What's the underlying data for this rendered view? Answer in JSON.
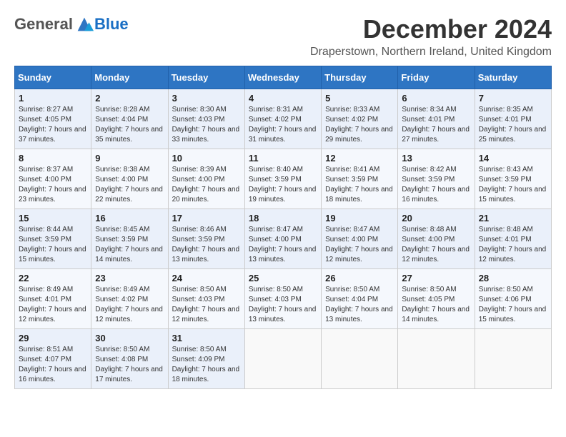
{
  "header": {
    "logo_general": "General",
    "logo_blue": "Blue",
    "main_title": "December 2024",
    "subtitle": "Draperstown, Northern Ireland, United Kingdom"
  },
  "calendar": {
    "days_of_week": [
      "Sunday",
      "Monday",
      "Tuesday",
      "Wednesday",
      "Thursday",
      "Friday",
      "Saturday"
    ],
    "weeks": [
      [
        {
          "day": "1",
          "sunrise": "Sunrise: 8:27 AM",
          "sunset": "Sunset: 4:05 PM",
          "daylight": "Daylight: 7 hours and 37 minutes."
        },
        {
          "day": "2",
          "sunrise": "Sunrise: 8:28 AM",
          "sunset": "Sunset: 4:04 PM",
          "daylight": "Daylight: 7 hours and 35 minutes."
        },
        {
          "day": "3",
          "sunrise": "Sunrise: 8:30 AM",
          "sunset": "Sunset: 4:03 PM",
          "daylight": "Daylight: 7 hours and 33 minutes."
        },
        {
          "day": "4",
          "sunrise": "Sunrise: 8:31 AM",
          "sunset": "Sunset: 4:02 PM",
          "daylight": "Daylight: 7 hours and 31 minutes."
        },
        {
          "day": "5",
          "sunrise": "Sunrise: 8:33 AM",
          "sunset": "Sunset: 4:02 PM",
          "daylight": "Daylight: 7 hours and 29 minutes."
        },
        {
          "day": "6",
          "sunrise": "Sunrise: 8:34 AM",
          "sunset": "Sunset: 4:01 PM",
          "daylight": "Daylight: 7 hours and 27 minutes."
        },
        {
          "day": "7",
          "sunrise": "Sunrise: 8:35 AM",
          "sunset": "Sunset: 4:01 PM",
          "daylight": "Daylight: 7 hours and 25 minutes."
        }
      ],
      [
        {
          "day": "8",
          "sunrise": "Sunrise: 8:37 AM",
          "sunset": "Sunset: 4:00 PM",
          "daylight": "Daylight: 7 hours and 23 minutes."
        },
        {
          "day": "9",
          "sunrise": "Sunrise: 8:38 AM",
          "sunset": "Sunset: 4:00 PM",
          "daylight": "Daylight: 7 hours and 22 minutes."
        },
        {
          "day": "10",
          "sunrise": "Sunrise: 8:39 AM",
          "sunset": "Sunset: 4:00 PM",
          "daylight": "Daylight: 7 hours and 20 minutes."
        },
        {
          "day": "11",
          "sunrise": "Sunrise: 8:40 AM",
          "sunset": "Sunset: 3:59 PM",
          "daylight": "Daylight: 7 hours and 19 minutes."
        },
        {
          "day": "12",
          "sunrise": "Sunrise: 8:41 AM",
          "sunset": "Sunset: 3:59 PM",
          "daylight": "Daylight: 7 hours and 18 minutes."
        },
        {
          "day": "13",
          "sunrise": "Sunrise: 8:42 AM",
          "sunset": "Sunset: 3:59 PM",
          "daylight": "Daylight: 7 hours and 16 minutes."
        },
        {
          "day": "14",
          "sunrise": "Sunrise: 8:43 AM",
          "sunset": "Sunset: 3:59 PM",
          "daylight": "Daylight: 7 hours and 15 minutes."
        }
      ],
      [
        {
          "day": "15",
          "sunrise": "Sunrise: 8:44 AM",
          "sunset": "Sunset: 3:59 PM",
          "daylight": "Daylight: 7 hours and 15 minutes."
        },
        {
          "day": "16",
          "sunrise": "Sunrise: 8:45 AM",
          "sunset": "Sunset: 3:59 PM",
          "daylight": "Daylight: 7 hours and 14 minutes."
        },
        {
          "day": "17",
          "sunrise": "Sunrise: 8:46 AM",
          "sunset": "Sunset: 3:59 PM",
          "daylight": "Daylight: 7 hours and 13 minutes."
        },
        {
          "day": "18",
          "sunrise": "Sunrise: 8:47 AM",
          "sunset": "Sunset: 4:00 PM",
          "daylight": "Daylight: 7 hours and 13 minutes."
        },
        {
          "day": "19",
          "sunrise": "Sunrise: 8:47 AM",
          "sunset": "Sunset: 4:00 PM",
          "daylight": "Daylight: 7 hours and 12 minutes."
        },
        {
          "day": "20",
          "sunrise": "Sunrise: 8:48 AM",
          "sunset": "Sunset: 4:00 PM",
          "daylight": "Daylight: 7 hours and 12 minutes."
        },
        {
          "day": "21",
          "sunrise": "Sunrise: 8:48 AM",
          "sunset": "Sunset: 4:01 PM",
          "daylight": "Daylight: 7 hours and 12 minutes."
        }
      ],
      [
        {
          "day": "22",
          "sunrise": "Sunrise: 8:49 AM",
          "sunset": "Sunset: 4:01 PM",
          "daylight": "Daylight: 7 hours and 12 minutes."
        },
        {
          "day": "23",
          "sunrise": "Sunrise: 8:49 AM",
          "sunset": "Sunset: 4:02 PM",
          "daylight": "Daylight: 7 hours and 12 minutes."
        },
        {
          "day": "24",
          "sunrise": "Sunrise: 8:50 AM",
          "sunset": "Sunset: 4:03 PM",
          "daylight": "Daylight: 7 hours and 12 minutes."
        },
        {
          "day": "25",
          "sunrise": "Sunrise: 8:50 AM",
          "sunset": "Sunset: 4:03 PM",
          "daylight": "Daylight: 7 hours and 13 minutes."
        },
        {
          "day": "26",
          "sunrise": "Sunrise: 8:50 AM",
          "sunset": "Sunset: 4:04 PM",
          "daylight": "Daylight: 7 hours and 13 minutes."
        },
        {
          "day": "27",
          "sunrise": "Sunrise: 8:50 AM",
          "sunset": "Sunset: 4:05 PM",
          "daylight": "Daylight: 7 hours and 14 minutes."
        },
        {
          "day": "28",
          "sunrise": "Sunrise: 8:50 AM",
          "sunset": "Sunset: 4:06 PM",
          "daylight": "Daylight: 7 hours and 15 minutes."
        }
      ],
      [
        {
          "day": "29",
          "sunrise": "Sunrise: 8:51 AM",
          "sunset": "Sunset: 4:07 PM",
          "daylight": "Daylight: 7 hours and 16 minutes."
        },
        {
          "day": "30",
          "sunrise": "Sunrise: 8:50 AM",
          "sunset": "Sunset: 4:08 PM",
          "daylight": "Daylight: 7 hours and 17 minutes."
        },
        {
          "day": "31",
          "sunrise": "Sunrise: 8:50 AM",
          "sunset": "Sunset: 4:09 PM",
          "daylight": "Daylight: 7 hours and 18 minutes."
        },
        null,
        null,
        null,
        null
      ]
    ]
  }
}
